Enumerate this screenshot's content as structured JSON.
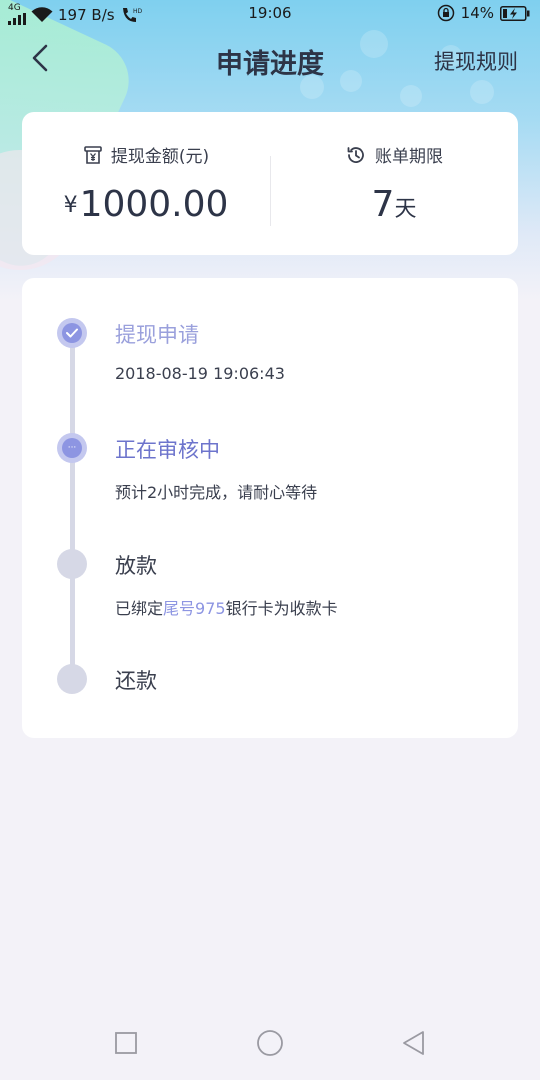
{
  "status_bar": {
    "network": "4G",
    "speed": "197 B/s",
    "time": "19:06",
    "battery": "14%"
  },
  "nav": {
    "title": "申请进度",
    "rules_label": "提现规则"
  },
  "summary": {
    "amount_label": "提现金额(元)",
    "currency_symbol": "¥",
    "amount_value": "1000.00",
    "term_label": "账单期限",
    "term_value": "7",
    "term_unit": "天"
  },
  "steps": [
    {
      "title": "提现申请",
      "subtitle": "2018-08-19 19:06:43",
      "state": "done"
    },
    {
      "title": "正在审核中",
      "subtitle": "预计2小时完成，请耐心等待",
      "state": "active"
    },
    {
      "title": "放款",
      "subtitle_prefix": "已绑定",
      "subtitle_highlight": "尾号975",
      "subtitle_suffix": "银行卡为收款卡",
      "state": "pending"
    },
    {
      "title": "还款",
      "state": "pending"
    }
  ],
  "colors": {
    "accent": "#8d95e2",
    "text_primary": "#2d3447",
    "node_inactive": "#d6d8e6"
  },
  "icons": {
    "summary_amount": "receipt-yen-icon",
    "summary_term": "history-clock-icon",
    "step_done": "check-icon",
    "step_active": "ellipsis-icon",
    "nav_back": "chevron-left-icon",
    "system_nav": [
      "recent-apps-icon",
      "home-icon",
      "back-triangle-icon"
    ]
  }
}
